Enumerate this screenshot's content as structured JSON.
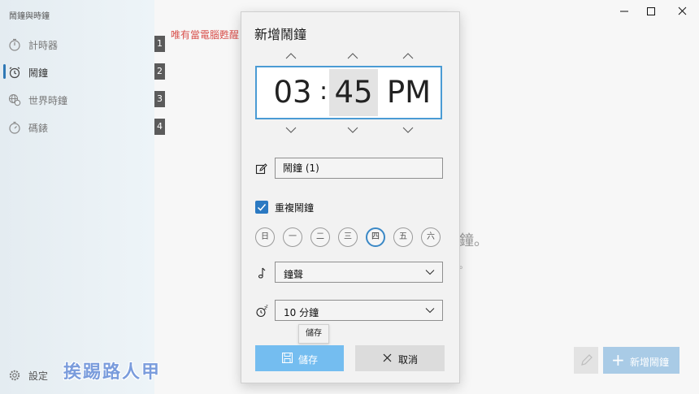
{
  "app_title": "鬧鐘與時鐘",
  "nav": {
    "items": [
      {
        "label": "計時器",
        "badge": "1"
      },
      {
        "label": "鬧鐘",
        "badge": "2"
      },
      {
        "label": "世界時鐘",
        "badge": "3"
      },
      {
        "label": "碼錶",
        "badge": "4"
      }
    ],
    "settings_label": "設定"
  },
  "watermark": "挨踢路人甲",
  "main": {
    "notice": "唯有當電腦甦醒",
    "bg_text1": "鐘。",
    "bg_text2": "。",
    "add_alarm_label": "新增鬧鐘"
  },
  "window_controls": {
    "minimize": "—",
    "maximize": "☐",
    "close": "✕"
  },
  "dialog": {
    "title": "新增鬧鐘",
    "time": {
      "hour": "03",
      "separator": ":",
      "minute": "45",
      "ampm": "PM"
    },
    "name_value": "鬧鐘 (1)",
    "repeat_label": "重複鬧鐘",
    "repeat_checked": true,
    "days": [
      {
        "label": "日",
        "selected": false
      },
      {
        "label": "一",
        "selected": false
      },
      {
        "label": "二",
        "selected": false
      },
      {
        "label": "三",
        "selected": false
      },
      {
        "label": "四",
        "selected": true
      },
      {
        "label": "五",
        "selected": false
      },
      {
        "label": "六",
        "selected": false
      }
    ],
    "sound_value": "鐘聲",
    "snooze_value": "10 分鐘",
    "tooltip": "儲存",
    "save_label": "儲存",
    "cancel_label": "取消"
  },
  "colors": {
    "accent": "#2b79c2",
    "save_button": "#74bdf0",
    "notice": "#d9534f",
    "badge": "#5b5b5b"
  }
}
